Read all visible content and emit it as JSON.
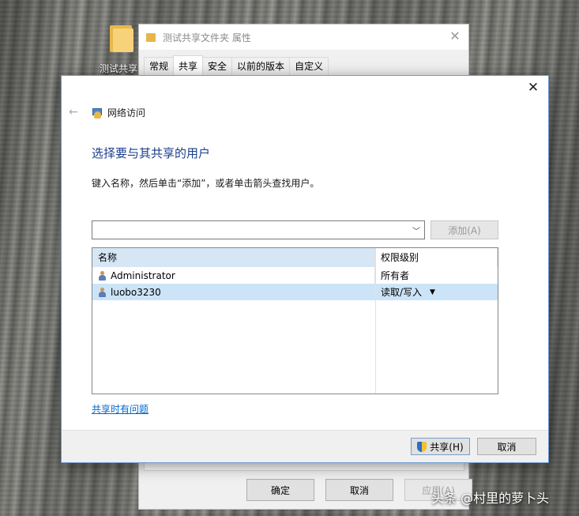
{
  "desktop": {
    "folder_label": "测试共享",
    "watermark": "头条 @村里的萝卜头"
  },
  "properties_window": {
    "title": "测试共享文件夹 属性",
    "tabs": [
      {
        "label": "常规",
        "active": false
      },
      {
        "label": "共享",
        "active": true
      },
      {
        "label": "安全",
        "active": false
      },
      {
        "label": "以前的版本",
        "active": false
      },
      {
        "label": "自定义",
        "active": false
      }
    ],
    "buttons": {
      "ok": "确定",
      "cancel": "取消",
      "apply": "应用(A)"
    }
  },
  "dialog": {
    "nav_title": "网络访问",
    "heading": "选择要与其共享的用户",
    "instruction": "键入名称，然后单击“添加”，或者单击箭头查找用户。",
    "name_input": {
      "value": ""
    },
    "add_button": "添加(A)",
    "table": {
      "columns": [
        "名称",
        "权限级别"
      ],
      "rows": [
        {
          "name": "Administrator",
          "permission": "所有者",
          "selected": false
        },
        {
          "name": "luobo3230",
          "permission": "读取/写入",
          "selected": true
        }
      ]
    },
    "trouble_link": "共享时有问题",
    "footer": {
      "share_button": "共享(H)",
      "cancel_button": "取消"
    }
  },
  "colors": {
    "heading": "#1a3e8c",
    "link": "#0066cc",
    "selection": "#cce4f7",
    "column_header": "#d7e6f5"
  }
}
